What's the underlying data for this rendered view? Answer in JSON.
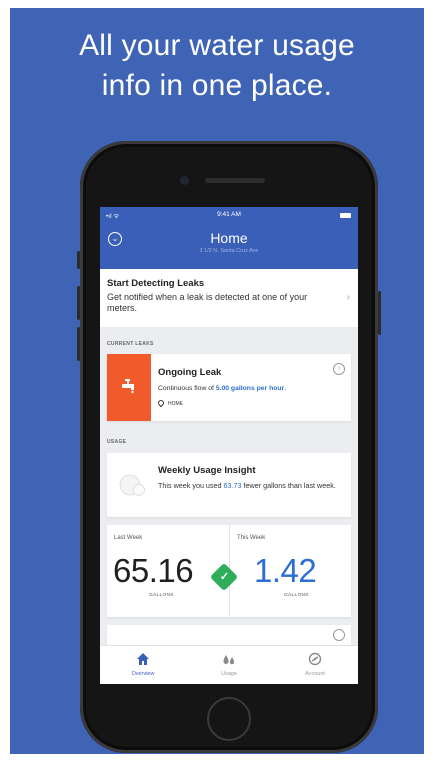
{
  "headline": {
    "line1": "All your water usage",
    "line2": "info in one place."
  },
  "status_bar": {
    "signal": "•ıl ᯤ",
    "time": "9:41 AM"
  },
  "header": {
    "title": "Home",
    "subtitle": "3 1/2 N. Santa Cruz Ave"
  },
  "banner": {
    "title": "Start Detecting Leaks",
    "body": "Get notified when a leak is detected at one of your meters."
  },
  "current_leaks": {
    "section_label": "CURRENT LEAKS",
    "title": "Ongoing Leak",
    "text_prefix": "Continuous flow of ",
    "flow": "5.00 gallons per hour",
    "text_suffix": ".",
    "location": "HOME"
  },
  "usage": {
    "section_label": "USAGE",
    "insight_title": "Weekly Usage Insight",
    "insight_prefix": "This week you used ",
    "insight_value": "63.73",
    "insight_suffix": " fewer gallons than last week.",
    "last_week": {
      "label": "Last Week",
      "value": "65.16",
      "unit": "GALLONS"
    },
    "this_week": {
      "label": "This Week",
      "value": "1.42",
      "unit": "GALLONS"
    }
  },
  "tabs": [
    {
      "label": "Overview",
      "icon": "home-icon",
      "active": true
    },
    {
      "label": "Usage",
      "icon": "water-drops-icon",
      "active": false
    },
    {
      "label": "Account",
      "icon": "account-icon",
      "active": false
    }
  ],
  "colors": {
    "background": "#3f63b5",
    "header": "#3a5fb8",
    "leak_accent": "#f15a2a",
    "highlight_blue": "#2d6dd6",
    "success_green": "#2eae5a"
  }
}
